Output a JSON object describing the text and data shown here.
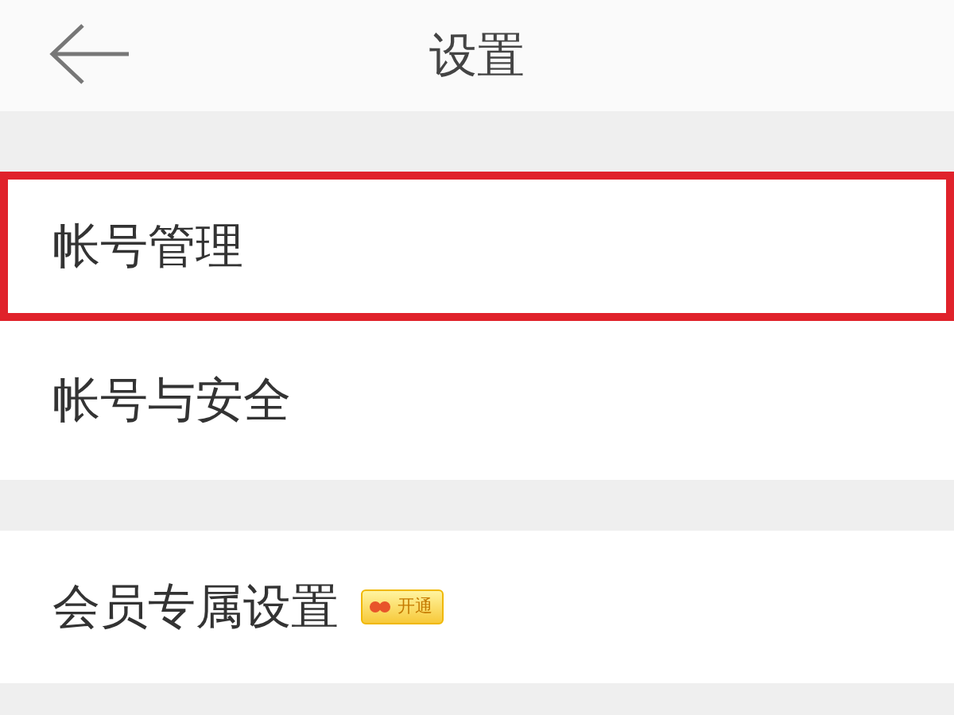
{
  "header": {
    "title": "设置"
  },
  "groups": [
    {
      "items": [
        {
          "label": "帐号管理",
          "highlighted": true
        },
        {
          "label": "帐号与安全",
          "highlighted": false
        }
      ]
    },
    {
      "items": [
        {
          "label": "会员专属设置",
          "highlighted": false,
          "badge": "开通"
        }
      ]
    }
  ]
}
